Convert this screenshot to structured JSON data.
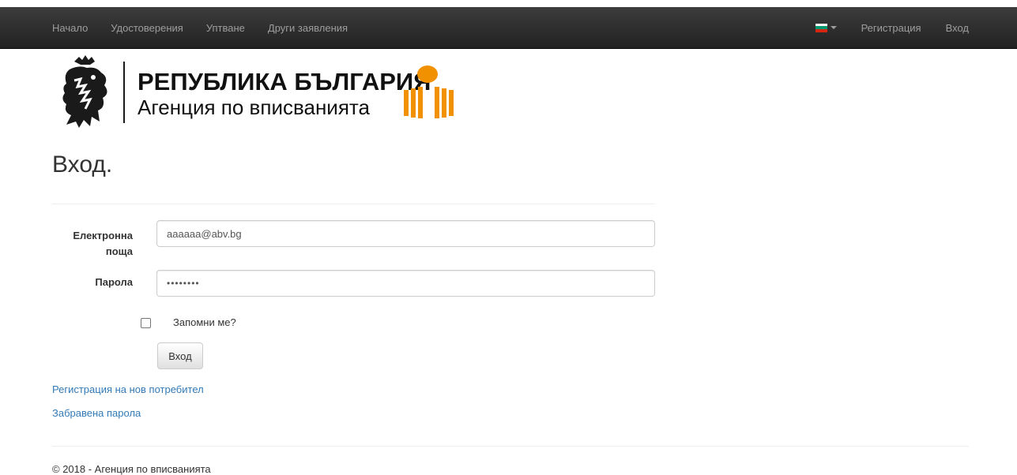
{
  "nav": {
    "left_items": [
      {
        "label": "Начало"
      },
      {
        "label": "Удостоверения"
      },
      {
        "label": "Уптване"
      },
      {
        "label": "Други заявления"
      }
    ],
    "language": {
      "icon": "bulgarian-flag-icon"
    },
    "register_label": "Регистрация",
    "login_label": "Вход"
  },
  "logo": {
    "line1": "РЕПУБЛИКА БЪЛГАРИЯ",
    "line2": "Агенция по вписванията"
  },
  "page": {
    "title": "Вход."
  },
  "form": {
    "email_label": "Електронна поща",
    "email_value": "aaaaaa@abv.bg",
    "password_label": "Парола",
    "password_value": "••••••••",
    "remember_label": "Запомни ме?",
    "remember_checked": false,
    "submit_label": "Вход"
  },
  "links": {
    "register_new": "Регистрация на нов потребител",
    "forgot_password": "Забравена парола"
  },
  "footer": {
    "text": "© 2018 - Агенция по вписванията"
  },
  "colors": {
    "navbar_bg": "#222222",
    "nav_text": "#9d9d9d",
    "link": "#337ab7",
    "logo_orange": "#f29100",
    "flag_white": "#ffffff",
    "flag_green": "#00966e",
    "flag_red": "#d62612"
  }
}
